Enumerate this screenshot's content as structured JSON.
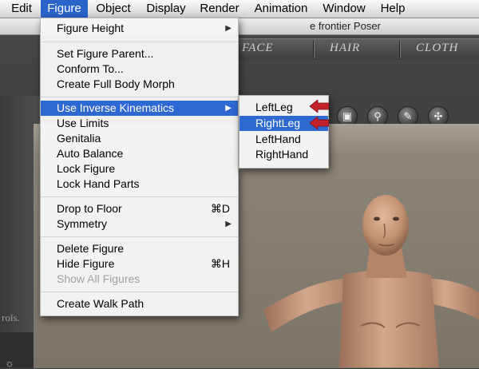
{
  "menubar": {
    "items": [
      {
        "label": "Edit"
      },
      {
        "label": "Figure"
      },
      {
        "label": "Object"
      },
      {
        "label": "Display"
      },
      {
        "label": "Render"
      },
      {
        "label": "Animation"
      },
      {
        "label": "Window"
      },
      {
        "label": "Help"
      }
    ],
    "active": "Figure"
  },
  "window": {
    "title": "e frontier Poser"
  },
  "tabs": [
    {
      "label": "FACE"
    },
    {
      "label": "HAIR"
    },
    {
      "label": "CLOTH"
    }
  ],
  "left_panel": {
    "hint_text": "rols."
  },
  "figure_menu": {
    "items": [
      {
        "label": "Figure Height",
        "submenu": true
      },
      {
        "label": "Set Figure Parent..."
      },
      {
        "label": "Conform To..."
      },
      {
        "label": "Create Full Body Morph"
      },
      {
        "label": "Use Inverse Kinematics",
        "submenu": true,
        "highlighted": true
      },
      {
        "label": "Use Limits"
      },
      {
        "label": "Genitalia"
      },
      {
        "label": "Auto Balance"
      },
      {
        "label": "Lock Figure"
      },
      {
        "label": "Lock Hand Parts"
      },
      {
        "label": "Drop to Floor",
        "shortcut": "⌘D"
      },
      {
        "label": "Symmetry",
        "submenu": true
      },
      {
        "label": "Delete Figure"
      },
      {
        "label": "Hide  Figure",
        "shortcut": "⌘H"
      },
      {
        "label": "Show All Figures",
        "disabled": true
      },
      {
        "label": "Create Walk Path"
      }
    ]
  },
  "ik_submenu": {
    "items": [
      {
        "label": "LeftLeg"
      },
      {
        "label": "RightLeg",
        "highlighted": true
      },
      {
        "label": "LeftHand"
      },
      {
        "label": "RightHand"
      }
    ]
  },
  "colors": {
    "highlight": "#2e68d1",
    "annotation_arrow": "#c4212a",
    "skin": "#c89a7c"
  },
  "icons": {
    "submenu_arrow": "▶",
    "toolbar": [
      "select-icon",
      "zoom-icon",
      "paint-icon",
      "move-icon"
    ],
    "light": "light-icon"
  }
}
